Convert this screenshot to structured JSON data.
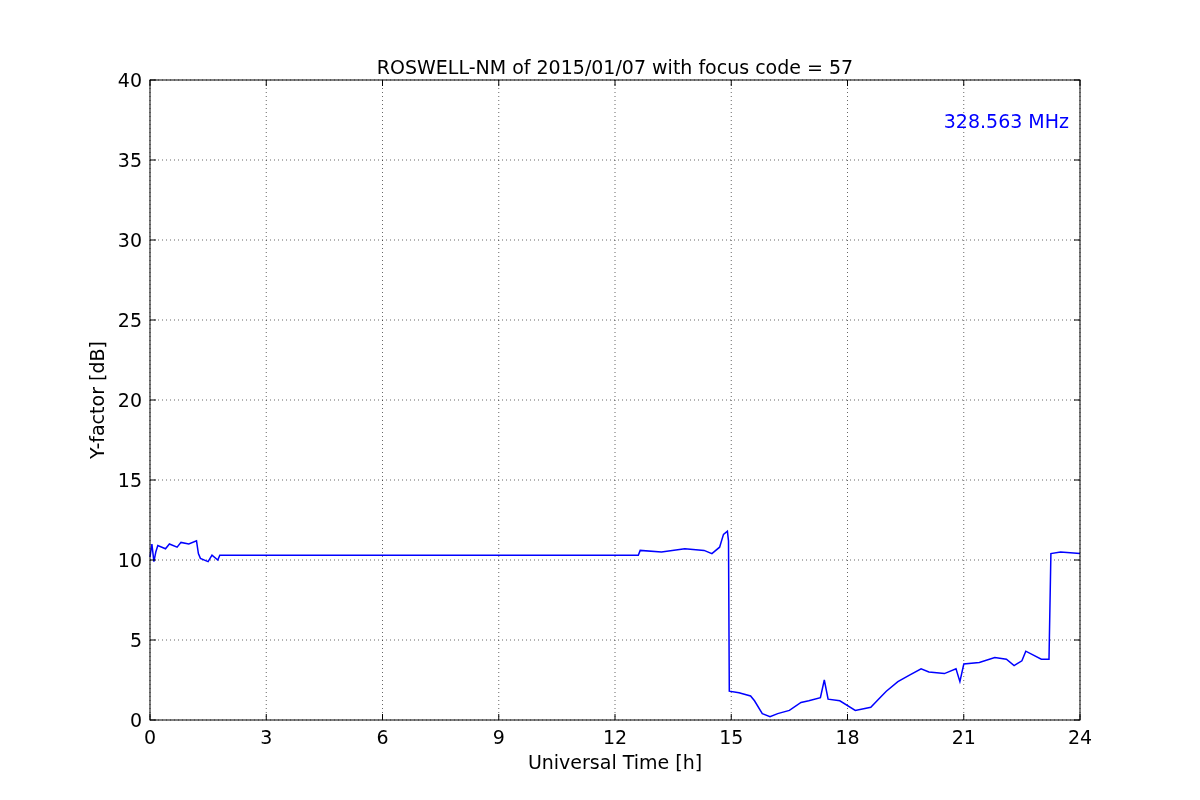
{
  "figure": {
    "chart_data": {
      "type": "line",
      "title": "ROSWELL-NM of 2015/01/07 with focus code = 57",
      "xlabel": "Universal Time [h]",
      "ylabel": "Y-factor [dB]",
      "x": [
        0,
        0.05,
        0.1,
        0.15,
        0.2,
        0.4,
        0.5,
        0.7,
        0.8,
        1.0,
        1.2,
        1.25,
        1.3,
        1.5,
        1.6,
        1.75,
        1.8,
        12.6,
        12.65,
        13.2,
        13.8,
        14.3,
        14.5,
        14.7,
        14.8,
        14.9,
        14.93,
        14.95,
        15.2,
        15.5,
        15.6,
        15.8,
        16.0,
        16.2,
        16.5,
        16.8,
        17.0,
        17.3,
        17.4,
        17.5,
        17.8,
        18.2,
        18.6,
        18.8,
        19.0,
        19.3,
        19.6,
        19.9,
        20.1,
        20.5,
        20.8,
        20.9,
        21.0,
        21.4,
        21.8,
        22.1,
        22.3,
        22.5,
        22.6,
        23.0,
        23.2,
        23.25,
        23.5,
        24
      ],
      "series": [
        {
          "name": "328.563 MHz",
          "color": "#0000ff",
          "values": [
            10.2,
            11.0,
            9.9,
            10.5,
            10.9,
            10.7,
            11.0,
            10.8,
            11.1,
            11.0,
            11.2,
            10.4,
            10.1,
            9.9,
            10.3,
            10.0,
            10.3,
            10.3,
            10.6,
            10.5,
            10.7,
            10.6,
            10.4,
            10.8,
            11.6,
            11.8,
            11.2,
            1.8,
            1.7,
            1.5,
            1.2,
            0.4,
            0.2,
            0.4,
            0.6,
            1.1,
            1.2,
            1.4,
            2.5,
            1.3,
            1.2,
            0.6,
            0.8,
            1.3,
            1.8,
            2.4,
            2.8,
            3.2,
            3.0,
            2.9,
            3.2,
            2.4,
            3.5,
            3.6,
            3.9,
            3.8,
            3.4,
            3.7,
            4.3,
            3.8,
            3.8,
            10.4,
            10.5,
            10.4
          ]
        }
      ],
      "xlim": [
        0,
        24
      ],
      "ylim": [
        0,
        40
      ],
      "xticks": [
        0,
        3,
        6,
        9,
        12,
        15,
        18,
        21,
        24
      ],
      "yticks": [
        0,
        5,
        10,
        15,
        20,
        25,
        30,
        35,
        40
      ],
      "grid": true
    }
  }
}
